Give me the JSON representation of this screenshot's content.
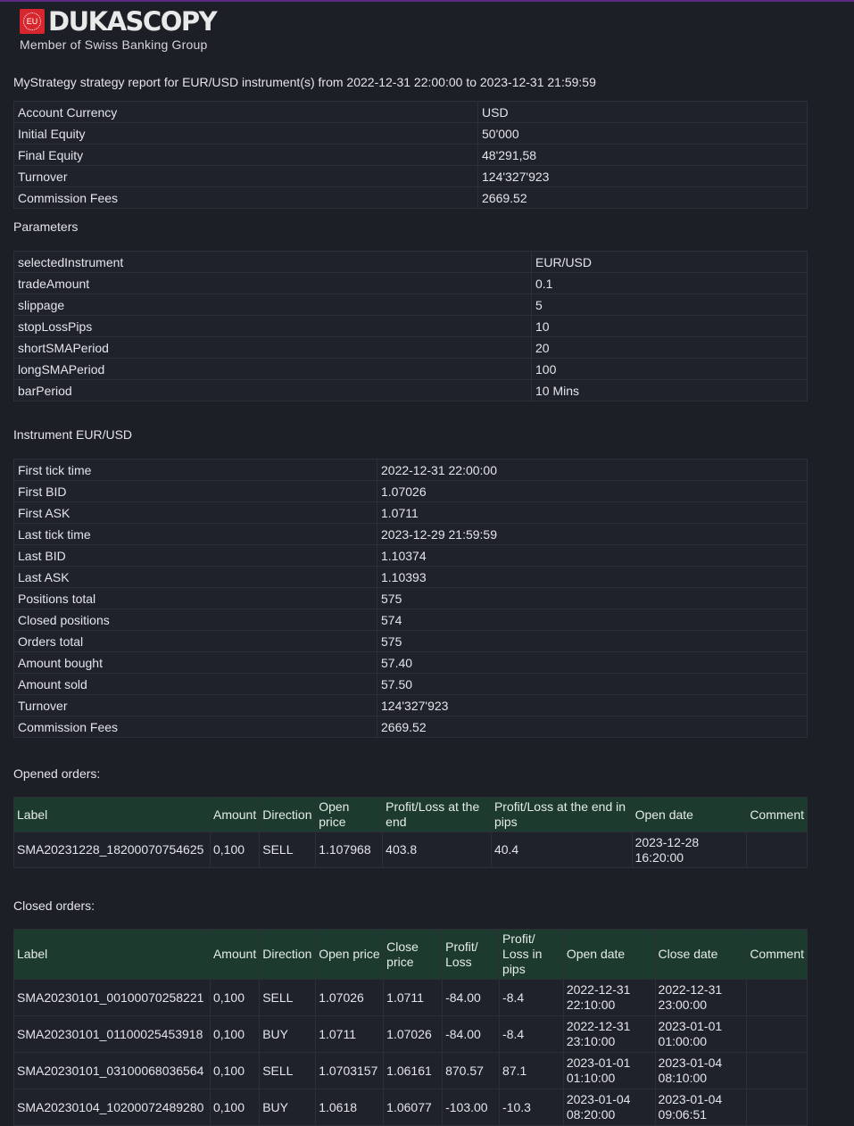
{
  "logo": {
    "badge_text": "EU",
    "brand": "DUKASCOPY",
    "tagline": "Member of Swiss Banking Group",
    "badge_color": "#d7262e"
  },
  "report_title": "MyStrategy strategy report for EUR/USD instrument(s) from 2022-12-31 22:00:00 to 2023-12-31 21:59:59",
  "summary": [
    [
      "Account Currency",
      "USD"
    ],
    [
      "Initial Equity",
      "50'000"
    ],
    [
      "Final Equity",
      "48'291,58"
    ],
    [
      "Turnover",
      "124'327'923"
    ],
    [
      "Commission Fees",
      "2669.52"
    ]
  ],
  "parameters_title": "Parameters",
  "parameters": [
    [
      "selectedInstrument",
      "EUR/USD"
    ],
    [
      "tradeAmount",
      "0.1"
    ],
    [
      "slippage",
      "5"
    ],
    [
      "stopLossPips",
      "10"
    ],
    [
      "shortSMAPeriod",
      "20"
    ],
    [
      "longSMAPeriod",
      "100"
    ],
    [
      "barPeriod",
      "10 Mins"
    ]
  ],
  "instrument_title": "Instrument EUR/USD",
  "instrument": [
    [
      "First tick time",
      "2022-12-31 22:00:00"
    ],
    [
      "First BID",
      "1.07026"
    ],
    [
      "First ASK",
      "1.0711"
    ],
    [
      "Last tick time",
      "2023-12-29 21:59:59"
    ],
    [
      "Last BID",
      "1.10374"
    ],
    [
      "Last ASK",
      "1.10393"
    ],
    [
      "Positions total",
      "575"
    ],
    [
      "Closed positions",
      "574"
    ],
    [
      "Orders total",
      "575"
    ],
    [
      "Amount bought",
      "57.40"
    ],
    [
      "Amount sold",
      "57.50"
    ],
    [
      "Turnover",
      "124'327'923"
    ],
    [
      "Commission Fees",
      "2669.52"
    ]
  ],
  "opened_title": "Opened orders:",
  "opened_headers": [
    "Label",
    "Amount",
    "Direction",
    "Open price",
    "Profit/Loss at the end",
    "Profit/Loss at the end in pips",
    "Open date",
    "Comment"
  ],
  "opened_rows": [
    [
      "SMA20231228_18200070754625",
      "0,100",
      "SELL",
      "1.107968",
      "403.8",
      "40.4",
      "2023-12-28 16:20:00",
      ""
    ]
  ],
  "closed_title": "Closed orders:",
  "closed_headers": [
    "Label",
    "Amount",
    "Direction",
    "Open price",
    "Close price",
    "Profit/ Loss",
    "Profit/ Loss in pips",
    "Open date",
    "Close date",
    "Comment"
  ],
  "closed_rows": [
    [
      "SMA20230101_00100070258221",
      "0,100",
      "SELL",
      "1.07026",
      "1.0711",
      "-84.00",
      "-8.4",
      "2022-12-31 22:10:00",
      "2022-12-31 23:00:00",
      ""
    ],
    [
      "SMA20230101_01100025453918",
      "0,100",
      "BUY",
      "1.0711",
      "1.07026",
      "-84.00",
      "-8.4",
      "2022-12-31 23:10:00",
      "2023-01-01 01:00:00",
      ""
    ],
    [
      "SMA20230101_03100068036564",
      "0,100",
      "SELL",
      "1.0703157",
      "1.06161",
      "870.57",
      "87.1",
      "2023-01-01 01:10:00",
      "2023-01-04 08:10:00",
      ""
    ],
    [
      "SMA20230104_10200072489280",
      "0,100",
      "BUY",
      "1.0618",
      "1.06077",
      "-103.00",
      "-10.3",
      "2023-01-04 08:20:00",
      "2023-01-04 09:06:51",
      ""
    ]
  ]
}
